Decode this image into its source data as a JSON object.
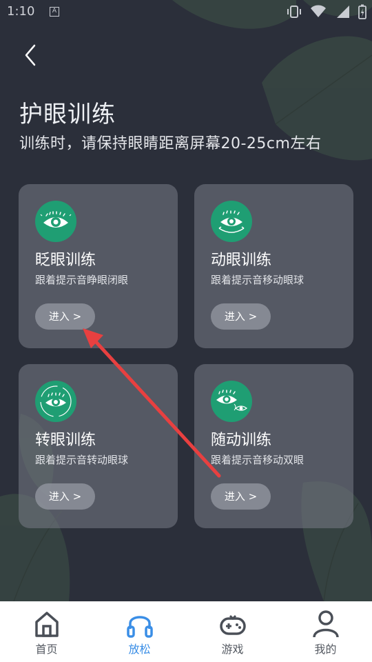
{
  "status_bar": {
    "time": "1:10",
    "notif_glyph": "A"
  },
  "header": {
    "back_icon": "chevron-left-icon",
    "title": "护眼训练",
    "subtitle": "训练时，请保持眼睛距离屏幕20-25cm左右"
  },
  "cards": [
    {
      "title": "眨眼训练",
      "desc": "跟着提示音睁眼闭眼",
      "button": "进入 >",
      "icon": "blink-eye-icon"
    },
    {
      "title": "动眼训练",
      "desc": "跟着提示音移动眼球",
      "button": "进入 >",
      "icon": "move-eye-icon"
    },
    {
      "title": "转眼训练",
      "desc": "跟着提示音转动眼球",
      "button": "进入 >",
      "icon": "rotate-eye-icon"
    },
    {
      "title": "随动训练",
      "desc": "跟着提示音移动双眼",
      "button": "进入 >",
      "icon": "follow-eye-icon"
    }
  ],
  "bottom_nav": [
    {
      "label": "首页",
      "icon": "home-icon",
      "active": false
    },
    {
      "label": "放松",
      "icon": "headphones-icon",
      "active": true
    },
    {
      "label": "游戏",
      "icon": "gamepad-icon",
      "active": false
    },
    {
      "label": "我的",
      "icon": "person-icon",
      "active": false
    }
  ],
  "colors": {
    "background": "#2b2f3a",
    "icon_green": "#1f9e73",
    "active_nav": "#3a8ee6",
    "annotation_arrow": "#e84040"
  }
}
